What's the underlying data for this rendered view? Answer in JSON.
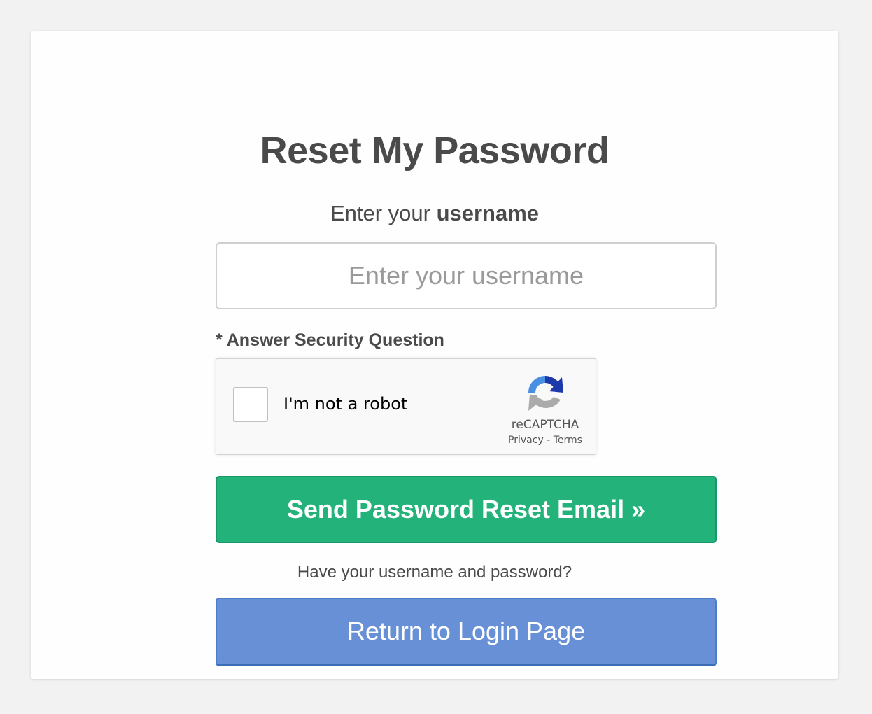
{
  "page": {
    "title": "Reset My Password",
    "prompt_prefix": "Enter your ",
    "prompt_bold": "username"
  },
  "username_field": {
    "placeholder": "Enter your username",
    "value": ""
  },
  "security": {
    "label": "* Answer Security Question"
  },
  "recaptcha": {
    "label": "I'm not a robot",
    "brand": "reCAPTCHA",
    "privacy": "Privacy",
    "separator": " - ",
    "terms": "Terms",
    "logo_icon": "recaptcha-logo-icon",
    "checked": false
  },
  "buttons": {
    "send_label": "Send Password Reset Email »",
    "have_text": "Have your username and password?",
    "login_label": "Return to Login Page"
  },
  "colors": {
    "background": "#f2f2f2",
    "card": "#fefefe",
    "text": "#4a4a4a",
    "send_button": "#22b27a",
    "login_button": "#6790d6"
  }
}
